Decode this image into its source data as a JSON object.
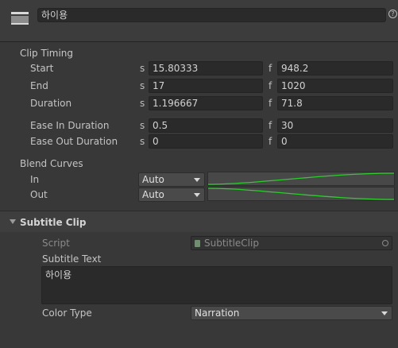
{
  "header": {
    "name_value": "하이용",
    "help_icon": "help-icon"
  },
  "clip_timing": {
    "title": "Clip Timing",
    "rows": [
      {
        "label": "Start",
        "s_value": "15.80333",
        "f_value": "948.2"
      },
      {
        "label": "End",
        "s_value": "17",
        "f_value": "1020"
      },
      {
        "label": "Duration",
        "s_value": "1.196667",
        "f_value": "71.8"
      },
      {
        "label": "Ease In Duration",
        "s_value": "0.5",
        "f_value": "30"
      },
      {
        "label": "Ease Out Duration",
        "s_value": "0",
        "f_value": "0"
      }
    ],
    "s_prefix": "s",
    "f_prefix": "f"
  },
  "blend_curves": {
    "title": "Blend Curves",
    "in_label": "In",
    "in_value": "Auto",
    "out_label": "Out",
    "out_value": "Auto",
    "curve_color": "#2ecc2e"
  },
  "subtitle_clip": {
    "title": "Subtitle Clip",
    "script_label": "Script",
    "script_value": "SubtitleClip",
    "subtitle_text_label": "Subtitle Text",
    "subtitle_text_value": "하이용",
    "color_type_label": "Color Type",
    "color_type_value": "Narration"
  }
}
